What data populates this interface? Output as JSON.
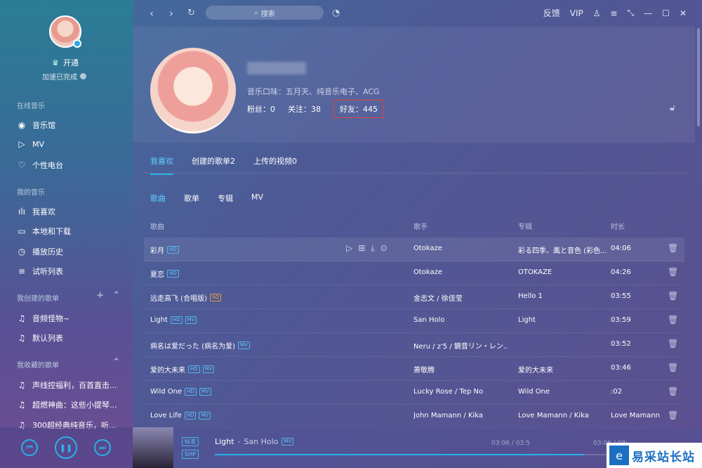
{
  "sidebar": {
    "vip_label": "开通",
    "speed_label": "加速已完成",
    "online_title": "在线音乐",
    "online_items": [
      {
        "label": "音乐馆",
        "icon": "music-hall-icon"
      },
      {
        "label": "MV",
        "icon": "mv-icon"
      },
      {
        "label": "个性电台",
        "icon": "radio-icon"
      }
    ],
    "my_title": "我的音乐",
    "my_items": [
      {
        "label": "我喜欢",
        "icon": "like-bars-icon"
      },
      {
        "label": "本地和下载",
        "icon": "monitor-icon"
      },
      {
        "label": "播放历史",
        "icon": "clock-icon"
      },
      {
        "label": "试听列表",
        "icon": "list-icon"
      }
    ],
    "created_title": "我创建的歌单",
    "created_items": [
      {
        "label": "音频怪物~",
        "icon": "note-icon"
      },
      {
        "label": "默认列表",
        "icon": "note-icon"
      }
    ],
    "collected_title": "我收藏的歌单",
    "collected_items": [
      {
        "label": "声线控福利，百首直击...",
        "icon": "note-icon"
      },
      {
        "label": "超燃神曲：这些小提琴...",
        "icon": "note-icon"
      },
      {
        "label": "300超经典纯音乐，听...",
        "icon": "note-icon"
      }
    ]
  },
  "topbar": {
    "search_placeholder": "搜索",
    "feedback": "反馈",
    "vip": "VIP"
  },
  "profile": {
    "taste": "音乐口味：五月天、纯音乐电子、ACG",
    "fans": "粉丝：0",
    "follow": "关注：38",
    "friends": "好友：445"
  },
  "tabs": [
    "我喜欢",
    "创建的歌单2",
    "上传的视频0"
  ],
  "subtabs": [
    "歌曲",
    "歌单",
    "专辑",
    "MV"
  ],
  "table": {
    "headers": {
      "song": "歌曲",
      "artist": "歌手",
      "album": "专辑",
      "duration": "时长"
    },
    "rows": [
      {
        "song": "彩月",
        "tags": [
          "HD"
        ],
        "artist": "Otokaze",
        "album": "彩る四季、風と音色 (彩色...",
        "duration": "04:06"
      },
      {
        "song": "夏恋",
        "tags": [
          "HD"
        ],
        "artist": "Otokaze",
        "album": "OTOKAZE",
        "duration": "04:26"
      },
      {
        "song": "远走高飞 (合唱版)",
        "tags": [
          "SQ"
        ],
        "artist": "金志文 / 徐佳莹",
        "album": "Hello 1",
        "duration": "03:55"
      },
      {
        "song": "Light",
        "tags": [
          "HD",
          "MV"
        ],
        "artist": "San Holo",
        "album": "Light",
        "duration": "03:59"
      },
      {
        "song": "病名は爱だった (病名为爱)",
        "tags": [
          "MV"
        ],
        "artist": "Neru / z'5 / 鏡音リン・レン...",
        "album": "",
        "duration": "03:52"
      },
      {
        "song": "爱的大未来",
        "tags": [
          "HD",
          "MV"
        ],
        "artist": "萧敬腾",
        "album": "爱的大未来",
        "duration": "03:46"
      },
      {
        "song": "Wild One",
        "tags": [
          "HD",
          "MV"
        ],
        "artist": "Lucky Rose / Tep No",
        "album": "Wild One",
        "duration": ":02"
      },
      {
        "song": "Love Life",
        "tags": [
          "HD",
          "MV"
        ],
        "artist": "John Mamann / Kika",
        "album": "Love Mamann / Kika",
        "duration": "Love Mamann"
      }
    ]
  },
  "player": {
    "quality_tag": "标准",
    "format_tag": "SHP",
    "title": "Light",
    "separator": "-",
    "artist": "San Holo",
    "mv_tag": "MV",
    "time_left": "03:06 / 03:5",
    "time_right": "03:06 / 03:",
    "progress": 0.78
  },
  "watermark": "易采站长站"
}
